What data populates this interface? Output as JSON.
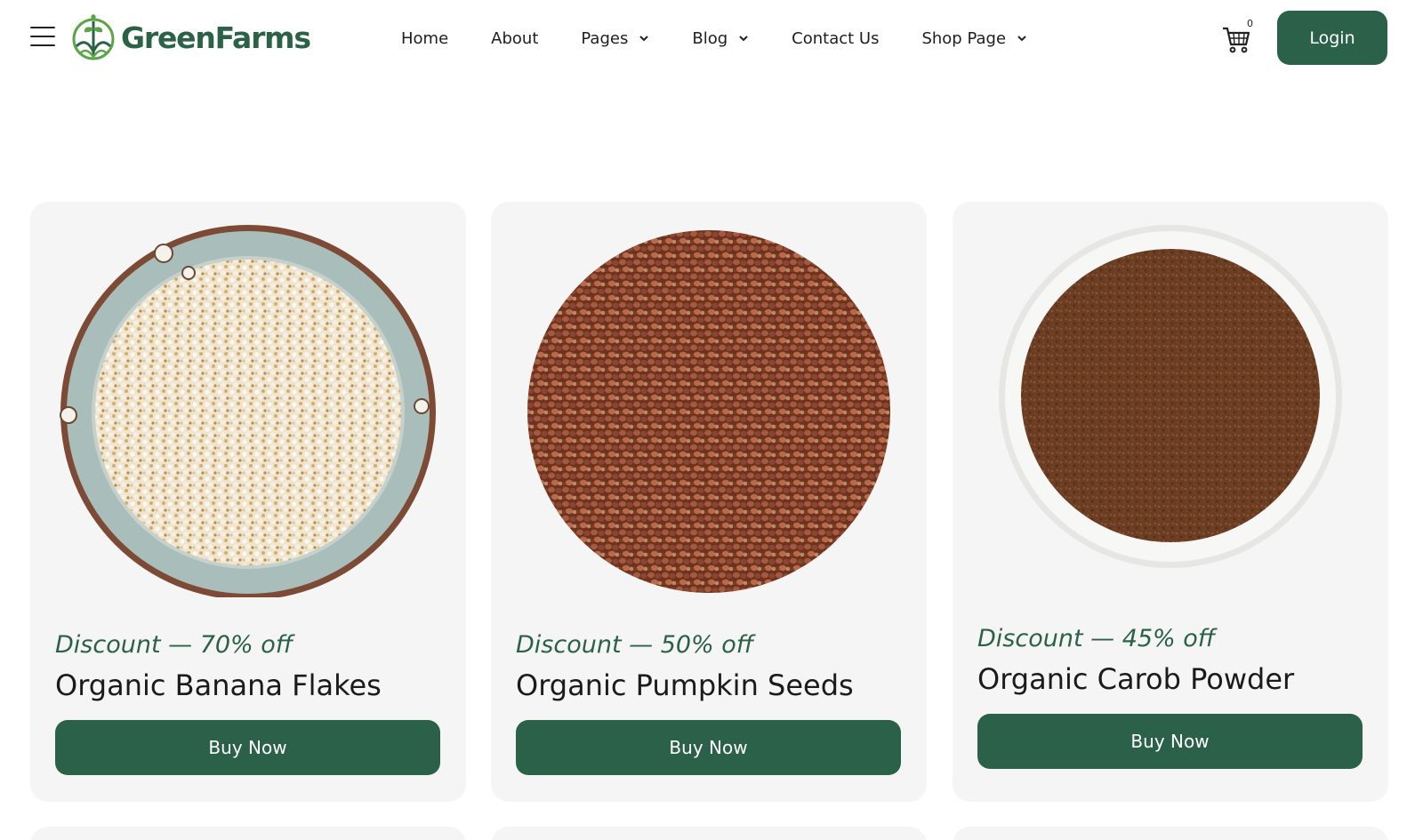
{
  "header": {
    "brand": "GreenFarms",
    "nav": [
      {
        "label": "Home",
        "has_dropdown": false
      },
      {
        "label": "About",
        "has_dropdown": false
      },
      {
        "label": "Pages",
        "has_dropdown": true
      },
      {
        "label": "Blog",
        "has_dropdown": true
      },
      {
        "label": "Contact Us",
        "has_dropdown": false
      },
      {
        "label": "Shop Page",
        "has_dropdown": true
      }
    ],
    "cart_count": "0",
    "login_label": "Login"
  },
  "products": [
    {
      "discount": "Discount  — 70% off",
      "name": "Organic Banana Flakes",
      "button": "Buy Now"
    },
    {
      "discount": "Discount  — 50% off",
      "name": "Organic Pumpkin Seeds",
      "button": "Buy Now"
    },
    {
      "discount": "Discount  — 45% off",
      "name": "Organic Carob Powder",
      "button": "Buy Now"
    }
  ],
  "colors": {
    "brand": "#2a6148",
    "card_bg": "#f5f5f5"
  },
  "icons": [
    "menu-icon",
    "leaf-logo-icon",
    "chevron-down-icon",
    "cart-icon"
  ]
}
